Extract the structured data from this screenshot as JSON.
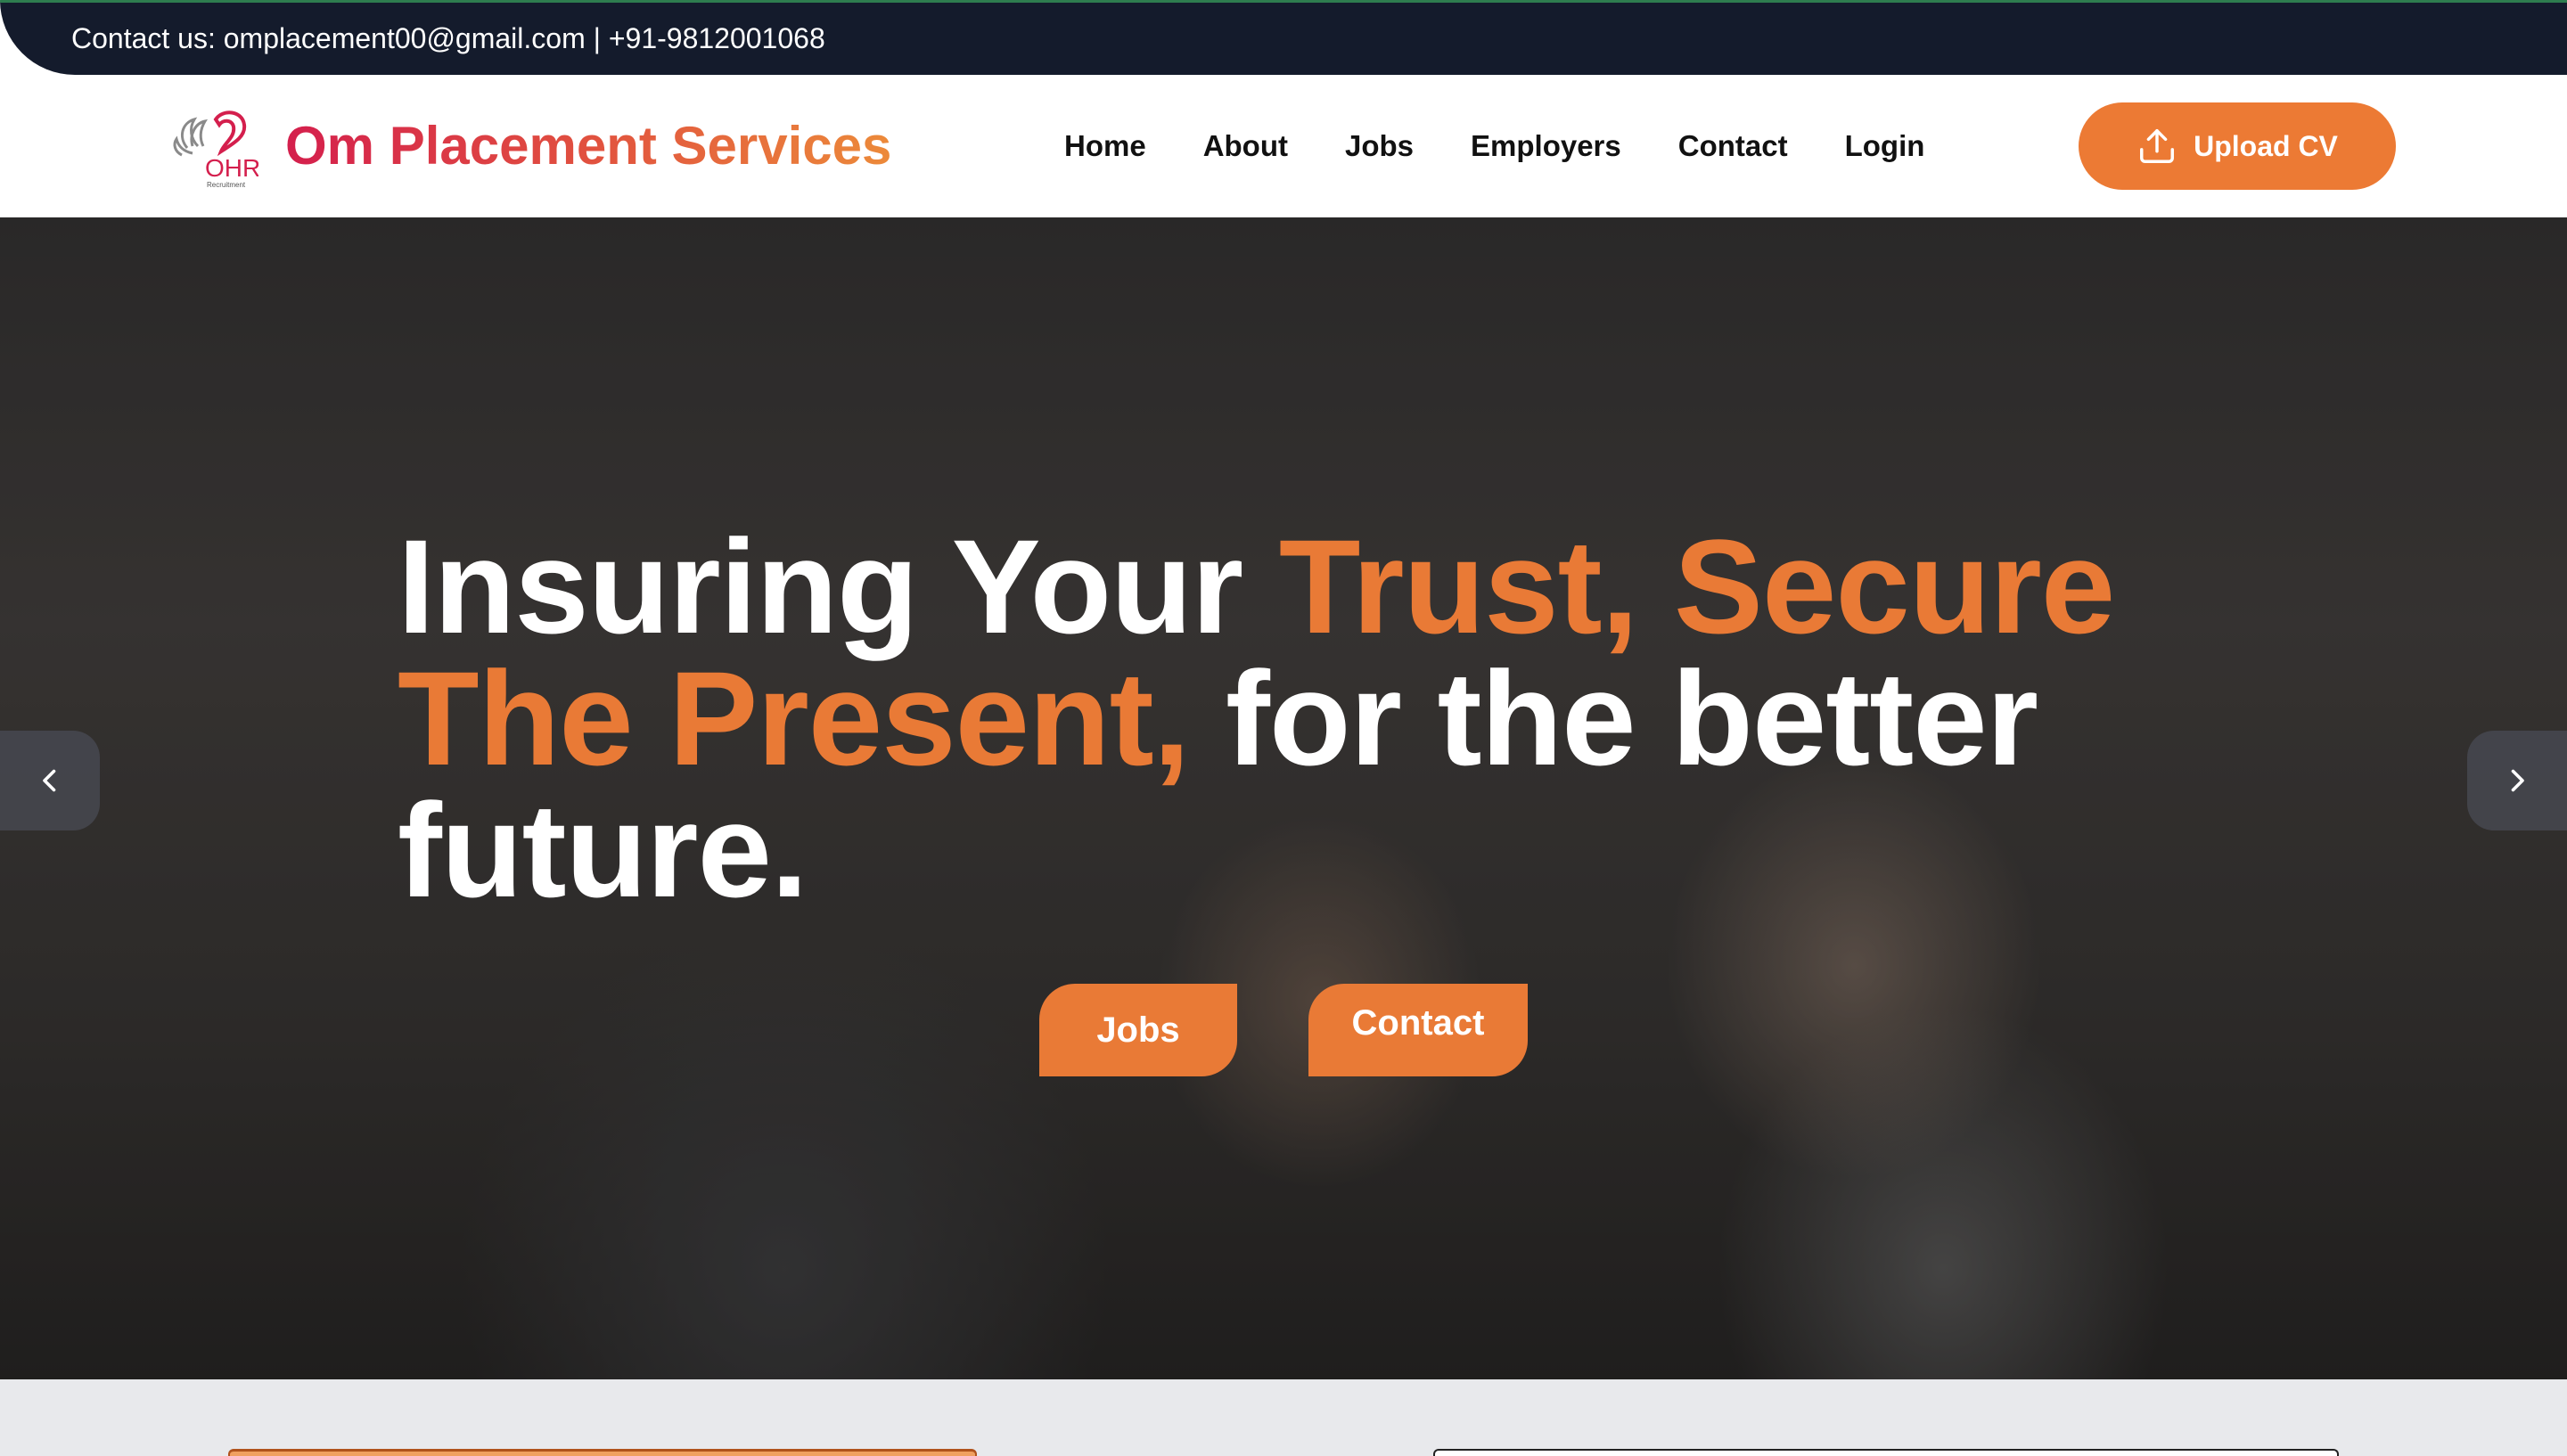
{
  "topbar": {
    "contact_text": "Contact us: omplacement00@gmail.com | +91-9812001068"
  },
  "header": {
    "logo_text": "OHR",
    "logo_subtext": "Recruitment",
    "brand": "Om Placement Services",
    "nav": [
      "Home",
      "About",
      "Jobs",
      "Employers",
      "Contact",
      "Login"
    ],
    "upload_label": "Upload CV"
  },
  "hero": {
    "headline_parts": {
      "p1": "Insuring Your ",
      "p2": "Trust, Secure The Present,",
      "p3": " for the better future."
    },
    "jobs_button": "Jobs",
    "contact_button": "Contact"
  },
  "colors": {
    "accent": "#e97a36",
    "brand_start": "#d41f4d",
    "topbar_bg": "#141b2c"
  },
  "icons": {
    "upload": "upload-icon",
    "prev": "chevron-left-icon",
    "next": "chevron-right-icon"
  }
}
